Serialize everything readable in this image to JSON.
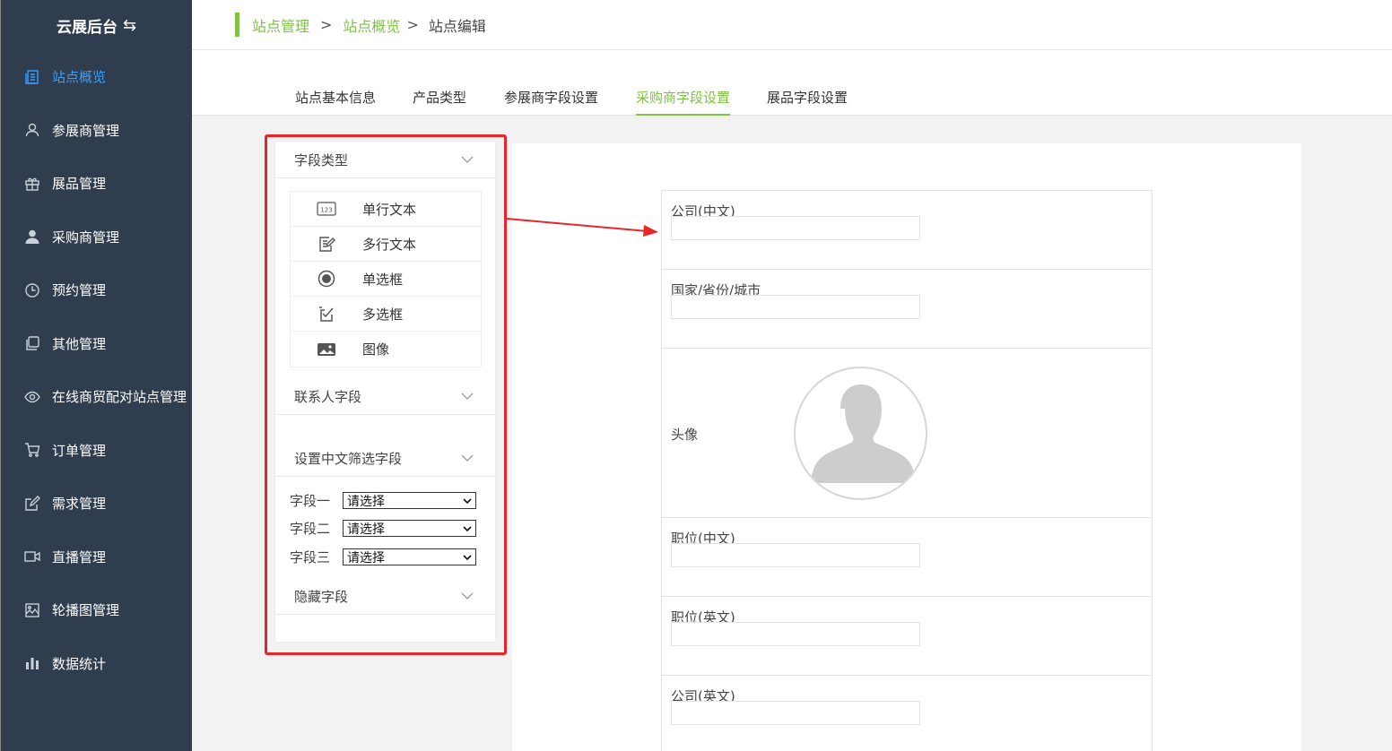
{
  "app": {
    "title": "云展后台",
    "swap_icon": "swap-icon"
  },
  "sidebar": {
    "items": [
      {
        "label": "站点概览",
        "icon": "document-icon",
        "active": true
      },
      {
        "label": "参展商管理",
        "icon": "user-outline-icon"
      },
      {
        "label": "展品管理",
        "icon": "gift-icon"
      },
      {
        "label": "采购商管理",
        "icon": "user-solid-icon"
      },
      {
        "label": "预约管理",
        "icon": "clock-icon"
      },
      {
        "label": "其他管理",
        "icon": "copy-icon"
      },
      {
        "label": "在线商贸配对站点管理",
        "icon": "eye-icon"
      },
      {
        "label": "订单管理",
        "icon": "cart-icon"
      },
      {
        "label": "需求管理",
        "icon": "edit-icon"
      },
      {
        "label": "直播管理",
        "icon": "video-icon"
      },
      {
        "label": "轮播图管理",
        "icon": "image-icon"
      },
      {
        "label": "数据统计",
        "icon": "bar-chart-icon"
      }
    ]
  },
  "breadcrumb": {
    "item1": "站点管理",
    "item2": "站点概览",
    "current": "站点编辑",
    "sep": ">"
  },
  "tabs": [
    {
      "label": "站点基本信息"
    },
    {
      "label": "产品类型"
    },
    {
      "label": "参展商字段设置"
    },
    {
      "label": "采购商字段设置",
      "active": true
    },
    {
      "label": "展品字段设置"
    }
  ],
  "panel": {
    "field_type_title": "字段类型",
    "field_types": [
      {
        "label": "单行文本",
        "icon": "text-123-icon"
      },
      {
        "label": "多行文本",
        "icon": "multiline-edit-icon"
      },
      {
        "label": "单选框",
        "icon": "radio-icon"
      },
      {
        "label": "多选框",
        "icon": "checkbox-icon"
      },
      {
        "label": "图像",
        "icon": "picture-icon"
      }
    ],
    "contact_title": "联系人字段",
    "filter_title": "设置中文筛选字段",
    "filters": [
      {
        "label": "字段一",
        "value": "请选择"
      },
      {
        "label": "字段二",
        "value": "请选择"
      },
      {
        "label": "字段三",
        "value": "请选择"
      }
    ],
    "hidden_title": "隐藏字段"
  },
  "form": {
    "rows": [
      {
        "label": "公司(中文)"
      },
      {
        "label": "国家/省份/城市"
      },
      {
        "label": "头像"
      },
      {
        "label": "职位(中文)"
      },
      {
        "label": "职位(英文)"
      },
      {
        "label": "公司(英文)"
      }
    ]
  },
  "colors": {
    "sidebar_bg": "#2f3d4e",
    "accent_green": "#7dc242",
    "active_blue": "#3aa0ff",
    "highlight_red": "#e8262a"
  }
}
